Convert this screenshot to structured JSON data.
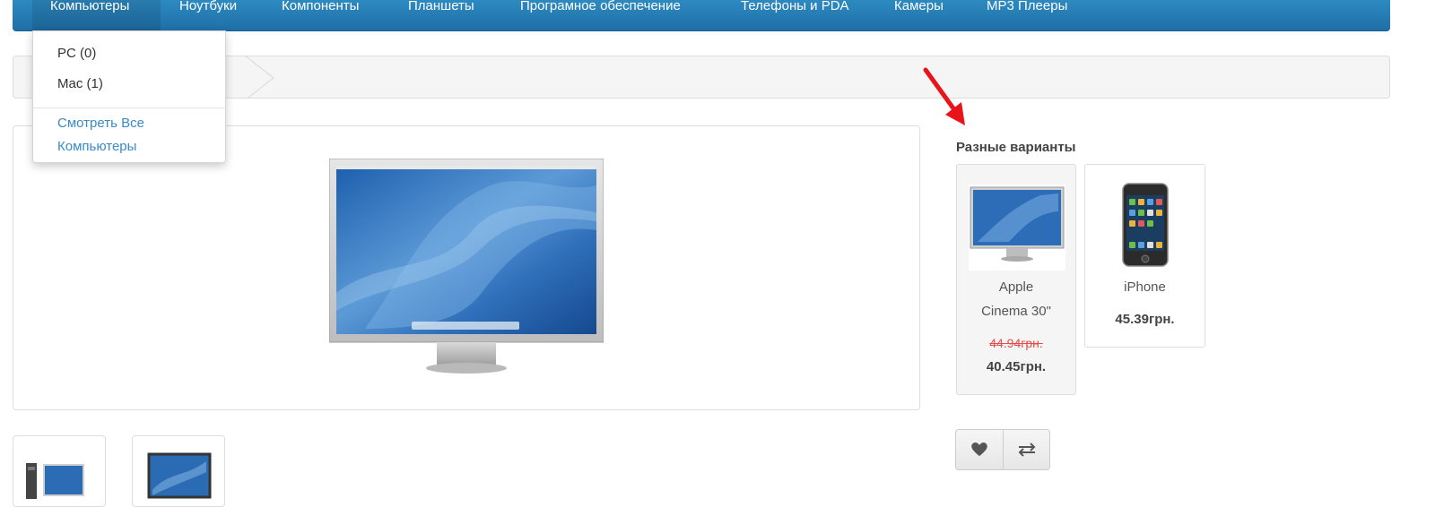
{
  "nav": {
    "items": [
      {
        "label": "Компьютеры"
      },
      {
        "label": "Ноутбуки"
      },
      {
        "label": "Компоненты"
      },
      {
        "label": "Планшеты"
      },
      {
        "label": "Програмное обеспечение"
      },
      {
        "label": "Телефоны и PDA"
      },
      {
        "label": "Камеры"
      },
      {
        "label": "MP3 Плееры"
      }
    ]
  },
  "dropdown": {
    "items": [
      {
        "label": "PC (0)"
      },
      {
        "label": "Mac (1)"
      }
    ],
    "view_all_line1": "Смотреть Все",
    "view_all_line2": "Компьютеры"
  },
  "variants": {
    "heading": "Разные варианты",
    "cards": [
      {
        "name_line1": "Apple",
        "name_line2": "Cinema 30\"",
        "old_price": "44.94грн.",
        "price": "40.45грн."
      },
      {
        "name_line1": "iPhone",
        "price": "45.39грн."
      }
    ]
  },
  "actions": {
    "wishlist_icon": "heart-icon",
    "compare_icon": "exchange-icon"
  },
  "colors": {
    "navbar": "#2d8ac1",
    "link": "#3a8ac6",
    "old_price": "#e84b4b",
    "arrow": "#e8141a"
  }
}
